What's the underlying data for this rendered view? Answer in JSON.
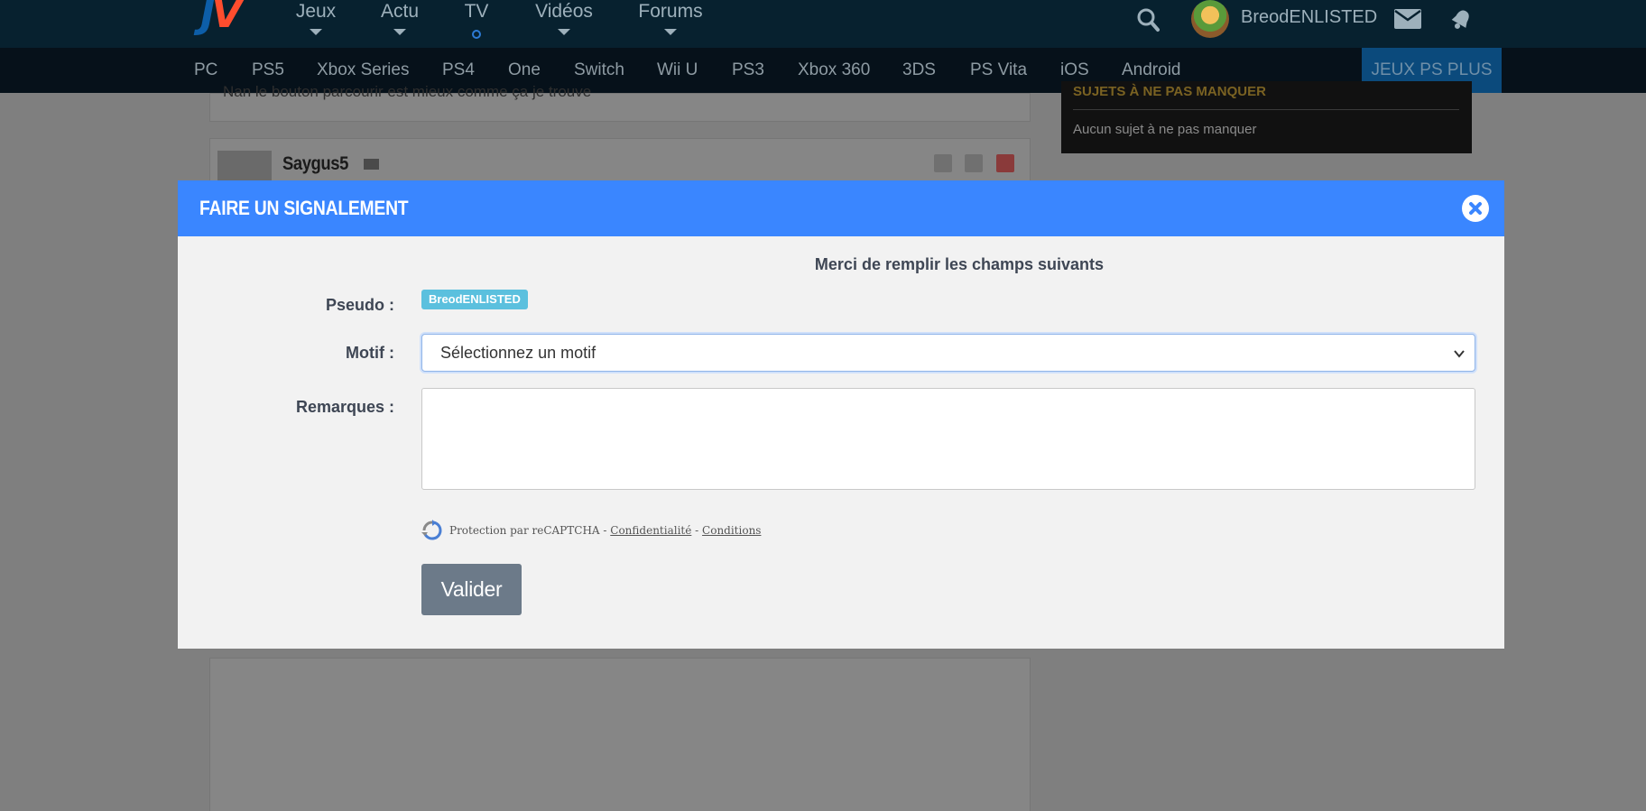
{
  "header": {
    "logo": {
      "text_j": "J",
      "text_v": "V"
    },
    "nav": [
      {
        "label": "Jeux",
        "marker": "caret"
      },
      {
        "label": "Actu",
        "marker": "caret"
      },
      {
        "label": "TV",
        "marker": "live-dot"
      },
      {
        "label": "Vidéos",
        "marker": "caret"
      },
      {
        "label": "Forums",
        "marker": "caret"
      }
    ],
    "user": {
      "name": "BreodENLISTED"
    },
    "icons": [
      "search-icon",
      "mail-icon",
      "bell-icon"
    ]
  },
  "platforms": [
    "PC",
    "PS5",
    "Xbox Series",
    "PS4",
    "One",
    "Switch",
    "Wii U",
    "PS3",
    "Xbox 360",
    "3DS",
    "PS Vita",
    "iOS",
    "Android"
  ],
  "platforms_promo": "JEUX PS PLUS",
  "background": {
    "post_text": "Nan le bouton parcourir est mieux comme ça je trouve",
    "author": "Saygus5",
    "side_title": "SUJETS À NE PAS MANQUER",
    "side_empty": "Aucun sujet à ne pas manquer"
  },
  "modal": {
    "title": "FAIRE UN SIGNALEMENT",
    "intro": "Merci de remplir les champs suivants",
    "pseudo_label": "Pseudo :",
    "pseudo_value": "BreodENLISTED",
    "motif_label": "Motif :",
    "motif_value": "Sélectionnez un motif",
    "remarques_label": "Remarques :",
    "remarques_value": "",
    "recaptcha": {
      "text": "Protection par reCAPTCHA",
      "sep1": " - ",
      "privacy": "Confidentialité",
      "sep2": " - ",
      "terms": "Conditions"
    },
    "submit_label": "Valider"
  },
  "colors": {
    "modal_header": "#3a86ff",
    "badge": "#5bc0de",
    "submit": "#6c7a89",
    "topbar": "#07212f"
  }
}
